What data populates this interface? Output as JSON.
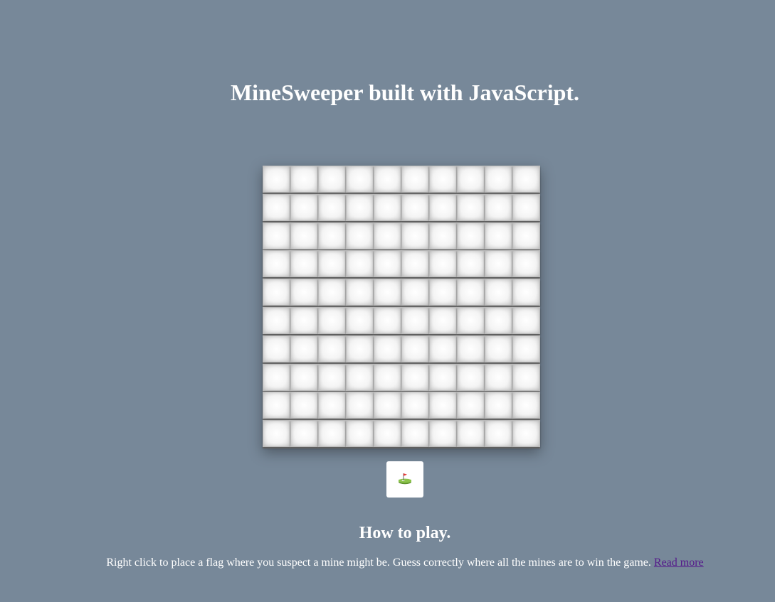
{
  "header": {
    "title": "MineSweeper built with JavaScript."
  },
  "board": {
    "rows": 10,
    "columns": 10,
    "cells_state": "unrevealed"
  },
  "controls": {
    "flag_button_icon": "golf-flag-icon"
  },
  "instructions": {
    "title": "How to play.",
    "text": "Right click to place a flag where you suspect a mine might be. Guess correctly where all the mines are to win the game. ",
    "link_label": "Read more"
  },
  "colors": {
    "background": "#778899",
    "link": "#551a8b",
    "flag_red": "#e53935",
    "grass_green": "#7cb342"
  }
}
